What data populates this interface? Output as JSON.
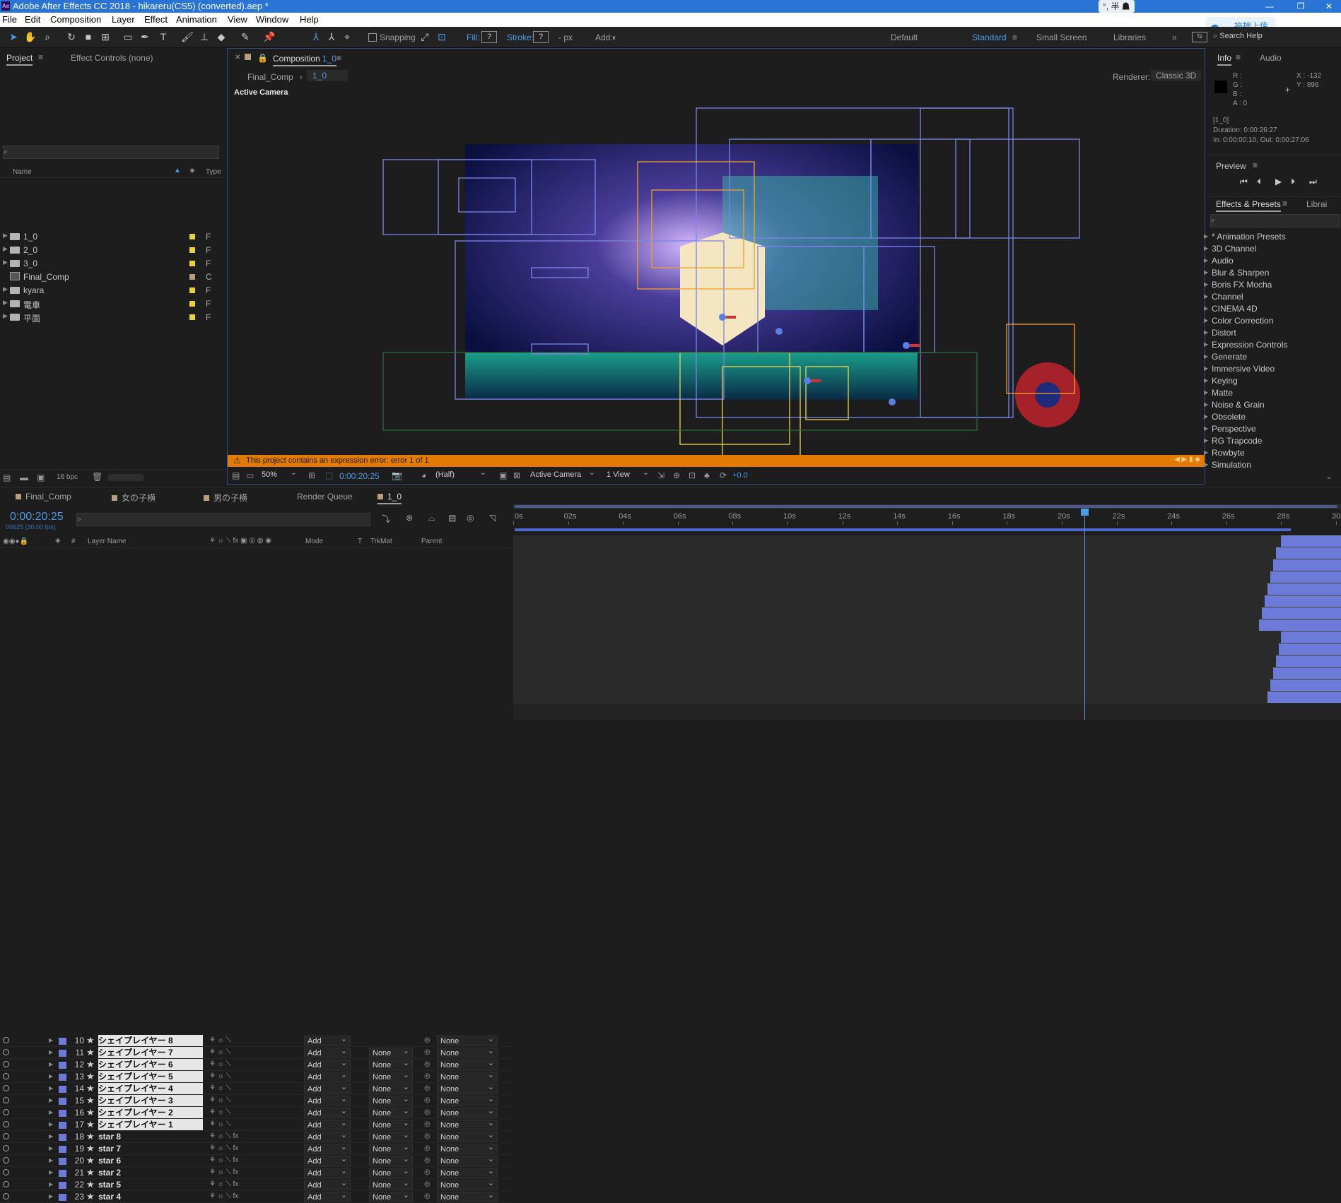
{
  "app": {
    "title": "Adobe After Effects CC 2018 - hikareru(CS5) (converted).aep *",
    "logo": "Ae",
    "ime_label": "拖拽上传",
    "ime_mode": "°, 半"
  },
  "menu": [
    "File",
    "Edit",
    "Composition",
    "Layer",
    "Effect",
    "Animation",
    "View",
    "Window",
    "Help"
  ],
  "toolbar": {
    "snapping": "Snapping",
    "fill": "Fill:",
    "fill_value": "?",
    "stroke": "Stroke:",
    "stroke_value": "?",
    "px": "- px",
    "add": "Add:",
    "workspaces": [
      "Default",
      "Standard",
      "Small Screen",
      "Libraries"
    ],
    "active_workspace": "Standard",
    "more": "»",
    "search_placeholder": "Search Help"
  },
  "project_panel": {
    "tab_project": "Project",
    "tab_effect_controls": "Effect Controls (none)",
    "col_name": "Name",
    "col_type": "Type",
    "items": [
      {
        "name": "1_0",
        "kind": "folder",
        "type": "F",
        "color": "#e8d140"
      },
      {
        "name": "2_0",
        "kind": "folder",
        "type": "F",
        "color": "#e8d140"
      },
      {
        "name": "3_0",
        "kind": "folder",
        "type": "F",
        "color": "#e8d140"
      },
      {
        "name": "Final_Comp",
        "kind": "comp",
        "type": "C",
        "color": "#b89e7a"
      },
      {
        "name": "kyara",
        "kind": "folder",
        "type": "F",
        "color": "#e8d140"
      },
      {
        "name": "電車",
        "kind": "folder",
        "type": "F",
        "color": "#e8d140"
      },
      {
        "name": "平面",
        "kind": "folder",
        "type": "F",
        "color": "#e8d140"
      }
    ],
    "bpc": "16 bpc"
  },
  "composition": {
    "tab": "Composition",
    "tab_name": "1_0",
    "breadcrumb_parent": "Final_Comp",
    "breadcrumb_current": "1_0",
    "renderer_label": "Renderer:",
    "renderer": "Classic 3D",
    "view_label": "Active Camera",
    "warning": "This project contains an expression error: error 1 of 1",
    "zoom": "50%",
    "timecode": "0:00:20:25",
    "resolution": "(Half)",
    "camera": "Active Camera",
    "views": "1 View",
    "exposure": "+0.0"
  },
  "info_panel": {
    "tab_info": "Info",
    "tab_audio": "Audio",
    "r": "R :",
    "g": "G :",
    "b": "B :",
    "a": "A :  0",
    "x": "X : -132",
    "y": "Y : 896",
    "layer": "[1_0]",
    "duration": "Duration: 0:00:26:27",
    "inout": "In: 0:00:00:10, Out: 0:00:27:06"
  },
  "preview": {
    "title": "Preview"
  },
  "effects": {
    "tab": "Effects & Presets",
    "tab2": "Librai",
    "items": [
      "* Animation Presets",
      "3D Channel",
      "Audio",
      "Blur & Sharpen",
      "Boris FX Mocha",
      "Channel",
      "CINEMA 4D",
      "Color Correction",
      "Distort",
      "Expression Controls",
      "Generate",
      "Immersive Video",
      "Keying",
      "Matte",
      "Noise & Grain",
      "Obsolete",
      "Perspective",
      "RG Trapcode",
      "Rowbyte",
      "Simulation"
    ]
  },
  "timeline": {
    "tabs": [
      "Final_Comp",
      "女の子横",
      "男の子横",
      "Render Queue",
      "1_0"
    ],
    "active_tab": "1_0",
    "timecode": "0:00:20:25",
    "frames": "00625 (30.00 fps)",
    "col_layer_name": "Layer Name",
    "col_mode": "Mode",
    "col_t": "T",
    "col_trkmat": "TrkMat",
    "col_parent": "Parent",
    "ruler": [
      "0s",
      "02s",
      "04s",
      "06s",
      "08s",
      "10s",
      "12s",
      "14s",
      "16s",
      "18s",
      "20s",
      "22s",
      "24s",
      "26s",
      "28s",
      "30s"
    ],
    "playhead_seconds": 20.83,
    "duration_seconds": 30,
    "layers": [
      {
        "num": "10",
        "name": "シェイプレイヤー 8",
        "kind": "shape",
        "mode": "Add",
        "trkmat": "",
        "parent": "None",
        "start": 28.0
      },
      {
        "num": "11",
        "name": "シェイプレイヤー 7",
        "kind": "shape",
        "mode": "Add",
        "trkmat": "None",
        "parent": "None",
        "start": 27.8
      },
      {
        "num": "12",
        "name": "シェイプレイヤー 6",
        "kind": "shape",
        "mode": "Add",
        "trkmat": "None",
        "parent": "None",
        "start": 27.7
      },
      {
        "num": "13",
        "name": "シェイプレイヤー 5",
        "kind": "shape",
        "mode": "Add",
        "trkmat": "None",
        "parent": "None",
        "start": 27.6
      },
      {
        "num": "14",
        "name": "シェイプレイヤー 4",
        "kind": "shape",
        "mode": "Add",
        "trkmat": "None",
        "parent": "None",
        "start": 27.5
      },
      {
        "num": "15",
        "name": "シェイプレイヤー 3",
        "kind": "shape",
        "mode": "Add",
        "trkmat": "None",
        "parent": "None",
        "start": 27.4
      },
      {
        "num": "16",
        "name": "シェイプレイヤー 2",
        "kind": "shape",
        "mode": "Add",
        "trkmat": "None",
        "parent": "None",
        "start": 27.3
      },
      {
        "num": "17",
        "name": "シェイプレイヤー 1",
        "kind": "shape",
        "mode": "Add",
        "trkmat": "None",
        "parent": "None",
        "start": 27.2
      },
      {
        "num": "18",
        "name": "star 8",
        "kind": "star",
        "mode": "Add",
        "trkmat": "None",
        "parent": "None",
        "start": 28.0
      },
      {
        "num": "19",
        "name": "star 7",
        "kind": "star",
        "mode": "Add",
        "trkmat": "None",
        "parent": "None",
        "start": 27.9
      },
      {
        "num": "20",
        "name": "star 6",
        "kind": "star",
        "mode": "Add",
        "trkmat": "None",
        "parent": "None",
        "start": 27.8
      },
      {
        "num": "21",
        "name": "star 2",
        "kind": "star",
        "mode": "Add",
        "trkmat": "None",
        "parent": "None",
        "start": 27.7
      },
      {
        "num": "22",
        "name": "star 5",
        "kind": "star",
        "mode": "Add",
        "trkmat": "None",
        "parent": "None",
        "start": 27.6
      },
      {
        "num": "23",
        "name": "star 4",
        "kind": "star",
        "mode": "Add",
        "trkmat": "None",
        "parent": "None",
        "start": 27.5
      }
    ]
  }
}
